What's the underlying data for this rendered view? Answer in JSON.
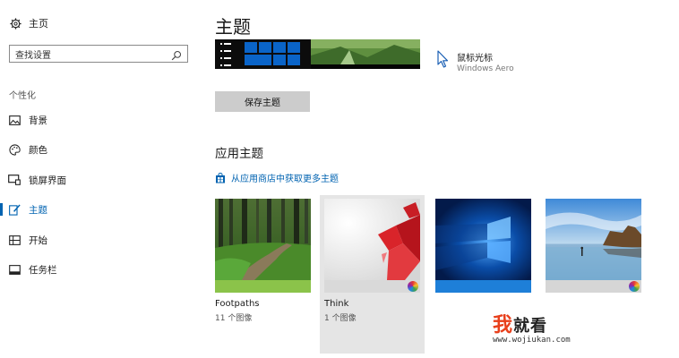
{
  "sidebar": {
    "home_label": "主页",
    "search_placeholder": "查找设置",
    "section_label": "个性化",
    "items": [
      {
        "label": "背景",
        "icon": "image-icon"
      },
      {
        "label": "颜色",
        "icon": "palette-icon"
      },
      {
        "label": "锁屏界面",
        "icon": "lock-screen-icon"
      },
      {
        "label": "主题",
        "icon": "theme-brush-icon",
        "active": true
      },
      {
        "label": "开始",
        "icon": "start-menu-icon"
      },
      {
        "label": "任务栏",
        "icon": "taskbar-icon"
      }
    ]
  },
  "main": {
    "title": "主题",
    "cursor": {
      "label": "鼠标光标",
      "value": "Windows Aero"
    },
    "save_button": "保存主题",
    "apply_title": "应用主题",
    "store_link": "从应用商店中获取更多主题",
    "themes": [
      {
        "name": "Footpaths",
        "count": "11 个图像",
        "accent": "#8bc34a"
      },
      {
        "name": "Think",
        "count": "1 个图像",
        "accent": "#d9d9d9",
        "selected": true
      },
      {
        "name": "",
        "count": "",
        "accent": "#1e7fd8"
      },
      {
        "name": "",
        "count": "",
        "accent": "#d6d6d6"
      }
    ]
  },
  "watermark": {
    "main_1": "我",
    "main_2": "就看",
    "sub": "www.wojiukan.com"
  },
  "colors": {
    "accent": "#0063b1",
    "button_bg": "#cccccc",
    "selected_bg": "#e5e5e5"
  }
}
